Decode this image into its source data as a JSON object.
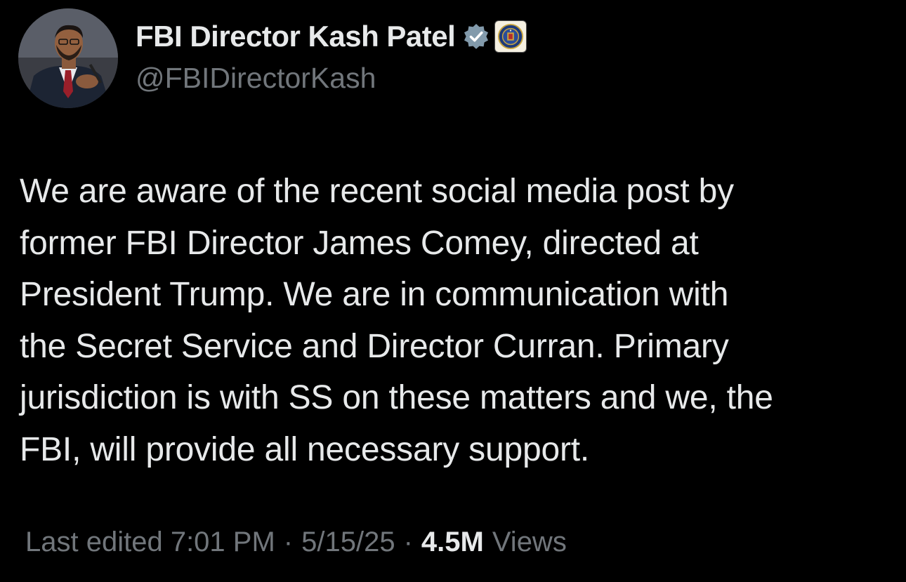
{
  "author": {
    "display_name": "FBI Director Kash Patel",
    "handle": "@FBIDirectorKash",
    "verified_badge_icon": "verified-badge-icon",
    "affiliate_badge_icon": "fbi-seal-icon",
    "verified_color": "#829aab"
  },
  "post": {
    "text": "We are aware of the recent social media post by\nformer FBI Director James Comey, directed at\nPresident Trump. We are in communication with\nthe Secret Service and Director Curran. Primary\njurisdiction is with SS on these matters and we, the\nFBI, will provide all necessary support."
  },
  "meta": {
    "edited_label": "Last edited 7:01 PM",
    "separator": "·",
    "date": "5/15/25",
    "views_count": "4.5M",
    "views_label": "Views"
  },
  "colors": {
    "background": "#000000",
    "primary_text": "#e7e9ea",
    "secondary_text": "#71767b"
  }
}
